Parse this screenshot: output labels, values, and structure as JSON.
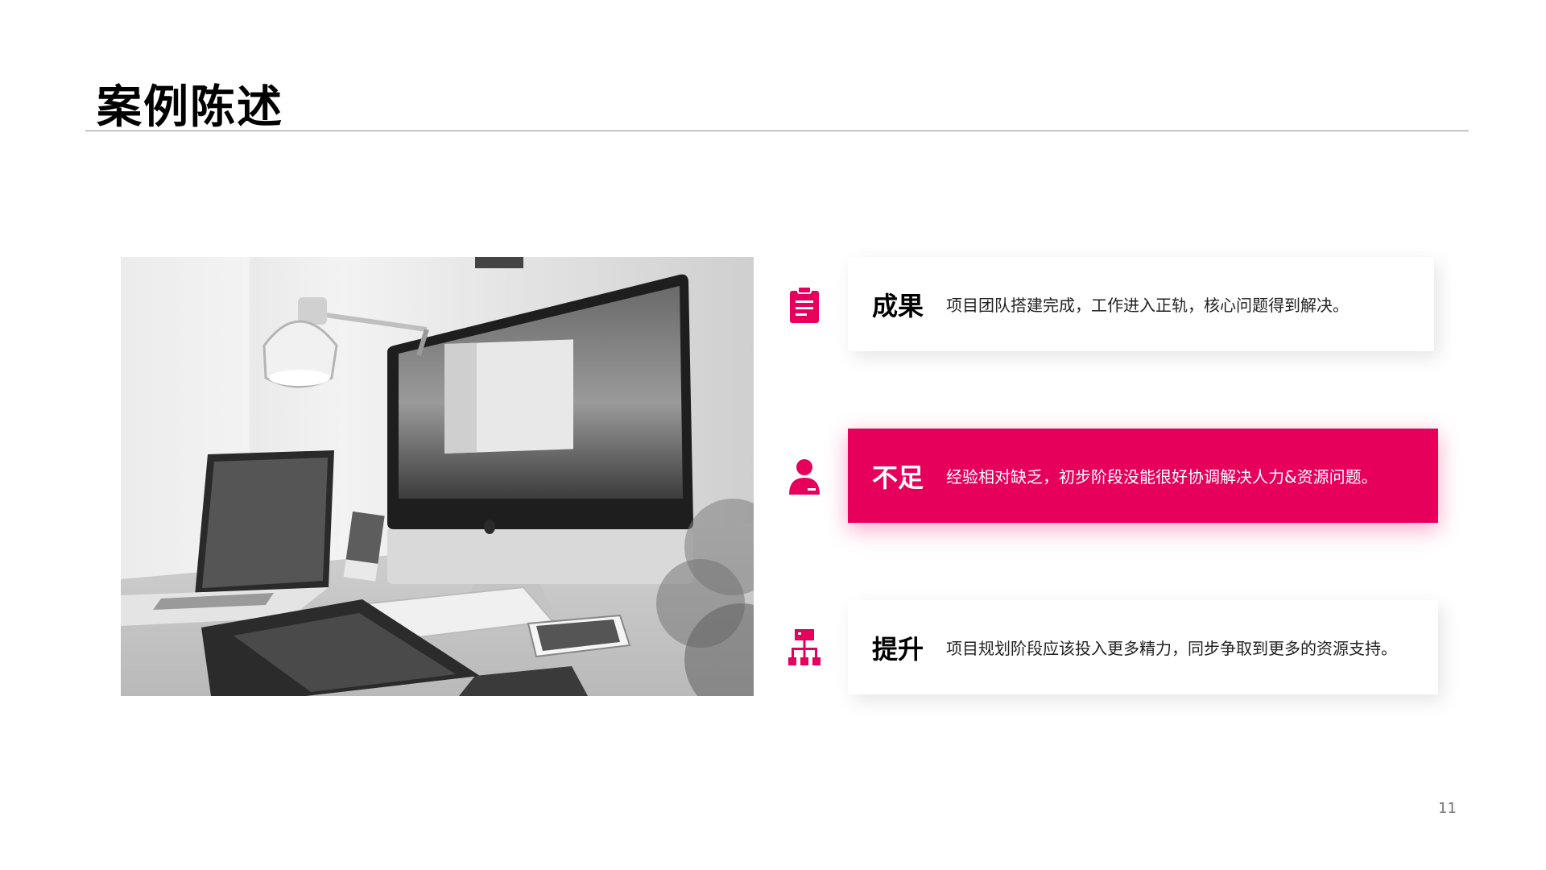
{
  "slide": {
    "title": "案例陈述",
    "page_number": "11",
    "accent_color": "#e6005c"
  },
  "photo": {
    "content": "grayscale photo of a desk with a desktop computer, laptop, drawing tablet, keyboard, phone, lamp and plant"
  },
  "rows": [
    {
      "icon": "clipboard-icon",
      "title": "成果",
      "text": "项目团队搭建完成，工作进入正轨，核心问题得到解决。",
      "highlighted": false
    },
    {
      "icon": "person-icon",
      "title": "不足",
      "text": "经验相对缺乏，初步阶段没能很好协调解决人力&资源问题。",
      "highlighted": true
    },
    {
      "icon": "org-chart-icon",
      "title": "提升",
      "text": "项目规划阶段应该投入更多精力，同步争取到更多的资源支持。",
      "highlighted": false
    }
  ]
}
